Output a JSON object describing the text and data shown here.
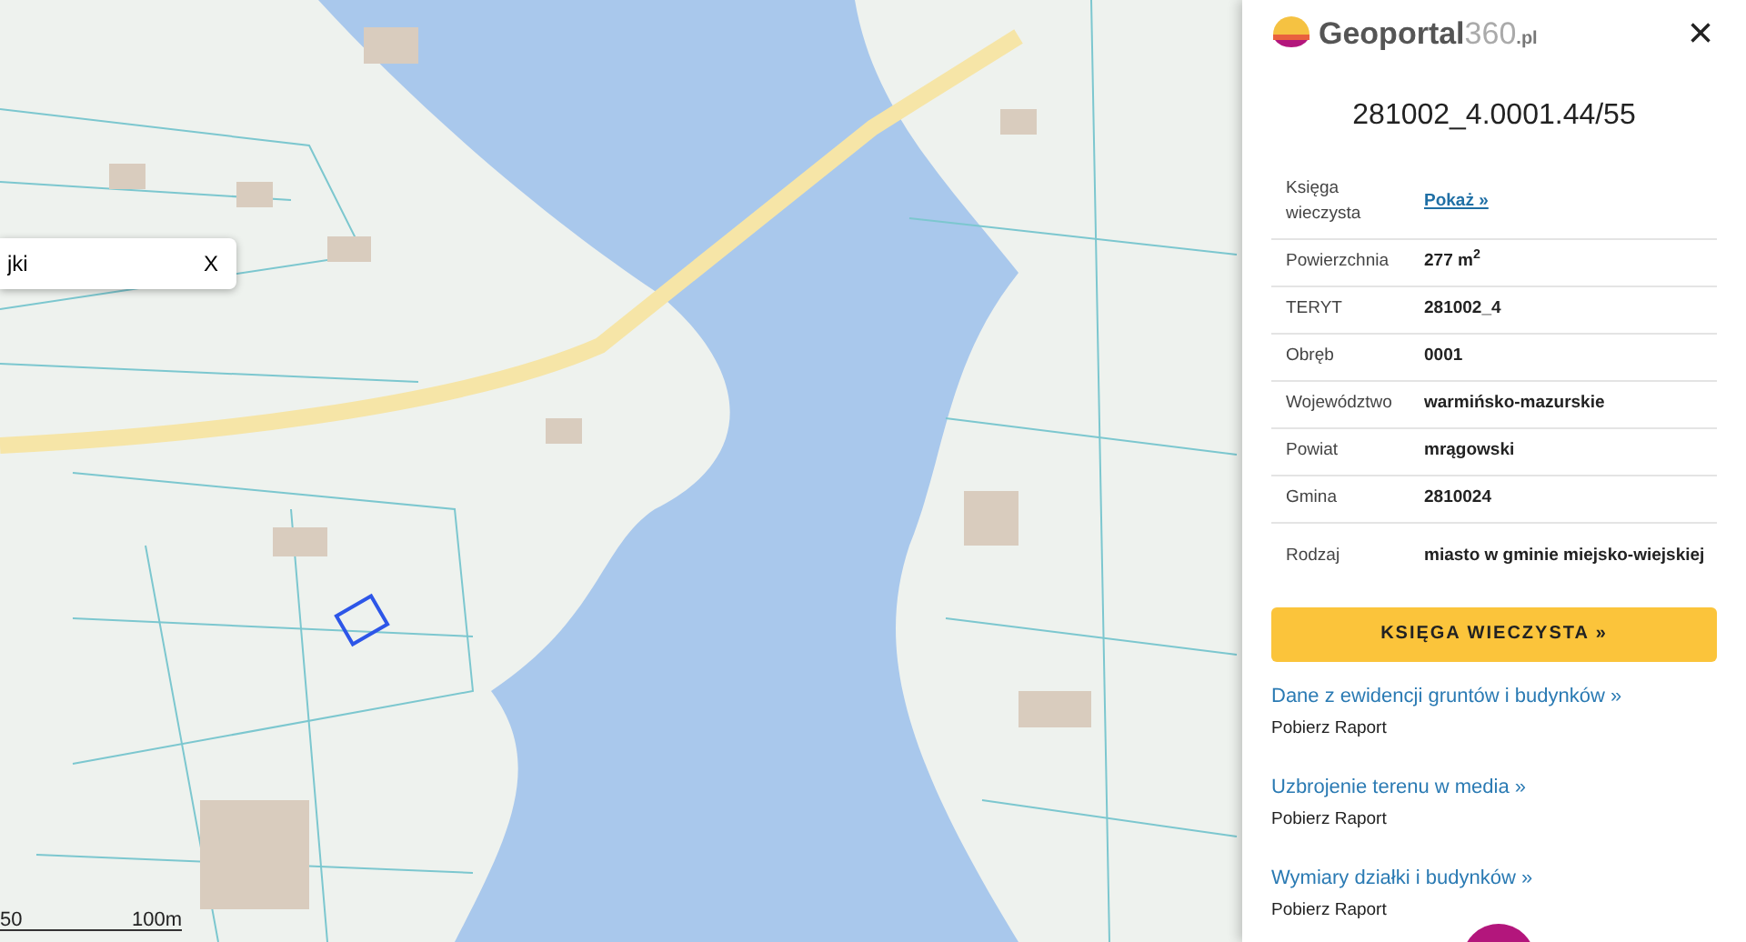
{
  "map": {
    "search": {
      "value": "jki",
      "clear": "X"
    },
    "scale": {
      "labels": [
        "50",
        "100m"
      ]
    }
  },
  "panel": {
    "logo": {
      "name": "Geoportal",
      "suffix": "360",
      "domain": ".pl"
    },
    "close": "×",
    "title": "281002_4.0001.44/55",
    "rows": [
      {
        "label": "Księga wieczysta",
        "value": "Pokaż »",
        "kind": "link"
      },
      {
        "label": "Powierzchnia",
        "value": "277 m$^{2}$",
        "kind": "text"
      },
      {
        "label": "TERYT",
        "value": "281002_4",
        "kind": "text"
      },
      {
        "label": "Obręb",
        "value": "0001",
        "kind": "text"
      },
      {
        "label": "Województwo",
        "value": "warmińsko-mazurskie",
        "kind": "text"
      },
      {
        "label": "Powiat",
        "value": "mrągowski",
        "kind": "text"
      },
      {
        "label": "Gmina",
        "value": "2810024",
        "kind": "text"
      },
      {
        "label": "Rodzaj",
        "value": "miasto w gminie miejsko-wiejskiej",
        "kind": "text"
      }
    ],
    "button": "KSIĘGA WIECZYSTA »",
    "reports": [
      {
        "title": "Dane z ewidencji gruntów i budynków »",
        "action": "Pobierz Raport"
      },
      {
        "title": "Uzbrojenie terenu w media »",
        "action": "Pobierz Raport"
      },
      {
        "title": "Wymiary działki i budynków »",
        "action": "Pobierz Raport"
      }
    ]
  }
}
